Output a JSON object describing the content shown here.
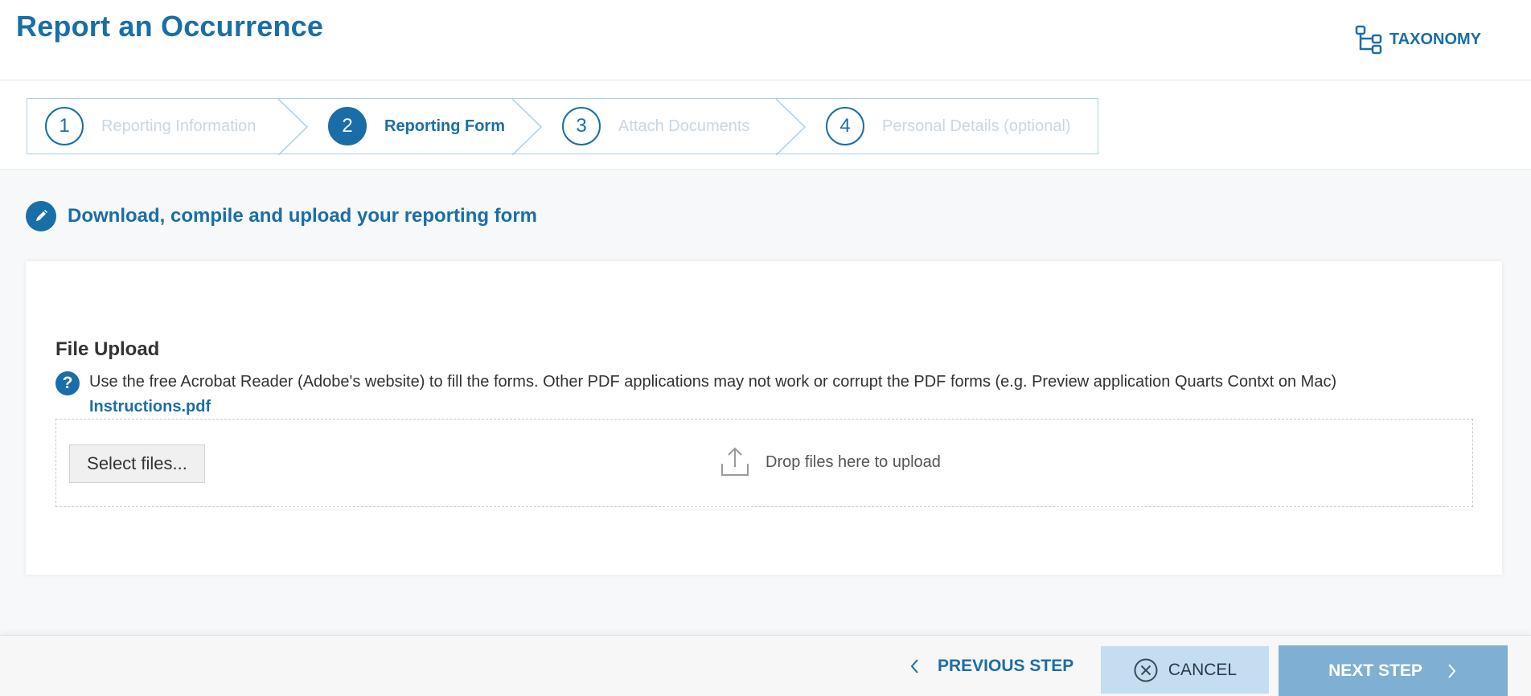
{
  "header": {
    "title": "Report an Occurrence",
    "taxonomy_label": "TAXONOMY"
  },
  "steps": [
    {
      "number": "1",
      "label": "Reporting Information",
      "active": false
    },
    {
      "number": "2",
      "label": "Reporting Form",
      "active": true
    },
    {
      "number": "3",
      "label": "Attach Documents",
      "active": false
    },
    {
      "number": "4",
      "label": "Personal Details (optional)",
      "active": false
    }
  ],
  "section": {
    "title": "Download, compile and upload your reporting form"
  },
  "upload": {
    "label": "File Upload",
    "help_text": "Use the free Acrobat Reader (Adobe's website) to fill the forms. Other PDF applications may not work or corrupt the PDF forms (e.g. Preview application Quarts Contxt on Mac)",
    "link_text": "Instructions.pdf",
    "select_button": "Select files...",
    "drop_text": "Drop files here to upload"
  },
  "footer": {
    "previous_label": "PREVIOUS STEP",
    "cancel_label": "CANCEL",
    "next_label": "NEXT STEP"
  },
  "colors": {
    "primary": "#1a6ea8",
    "next_button": "#7fb0d3",
    "cancel_button": "#c4ddf0"
  }
}
